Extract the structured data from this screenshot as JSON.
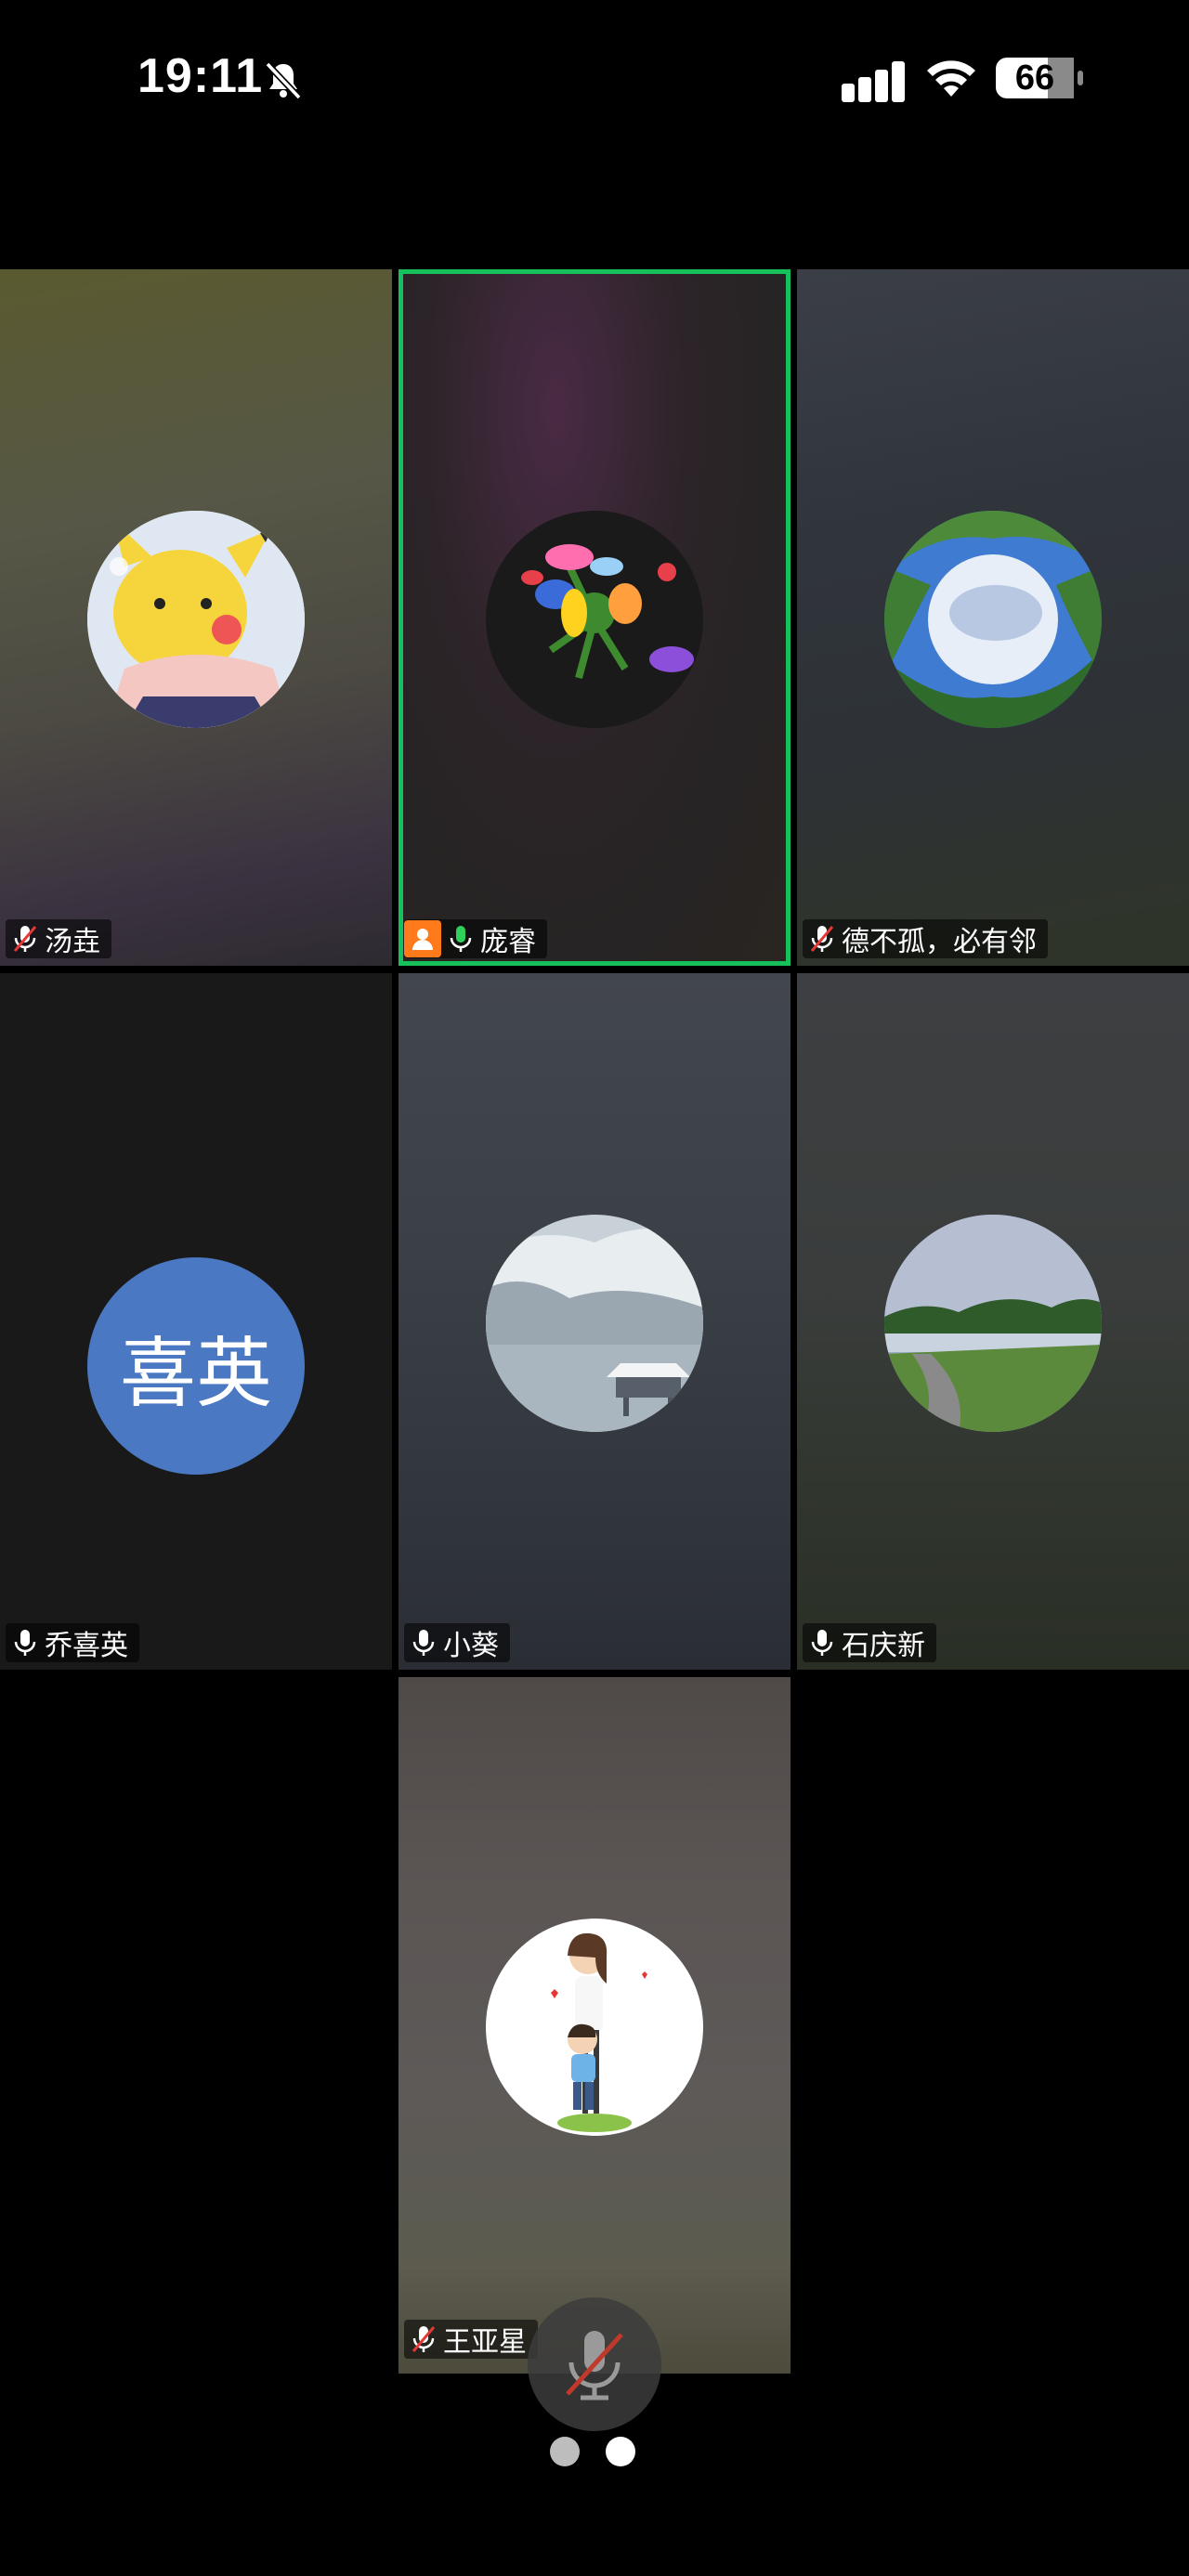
{
  "status_bar": {
    "time": "19:11",
    "battery": "66"
  },
  "participants": [
    {
      "name": "汤垚",
      "mic": "muted"
    },
    {
      "name": "庞睿",
      "mic": "on",
      "host": true,
      "active_speaker": true
    },
    {
      "name": "德不孤，必有邻",
      "mic": "muted"
    },
    {
      "name": "乔喜英",
      "mic": "on",
      "initials": "喜英"
    },
    {
      "name": "小葵",
      "mic": "on"
    },
    {
      "name": "石庆新",
      "mic": "on"
    },
    {
      "name": "王亚星",
      "mic": "muted"
    }
  ],
  "colors": {
    "active_border": "#16c05a",
    "host_badge": "#ff7a1a",
    "initials_avatar": "#4a78c2",
    "mute_slash": "#e53935"
  },
  "pagination": {
    "current_page": 1,
    "total_pages": 2
  }
}
